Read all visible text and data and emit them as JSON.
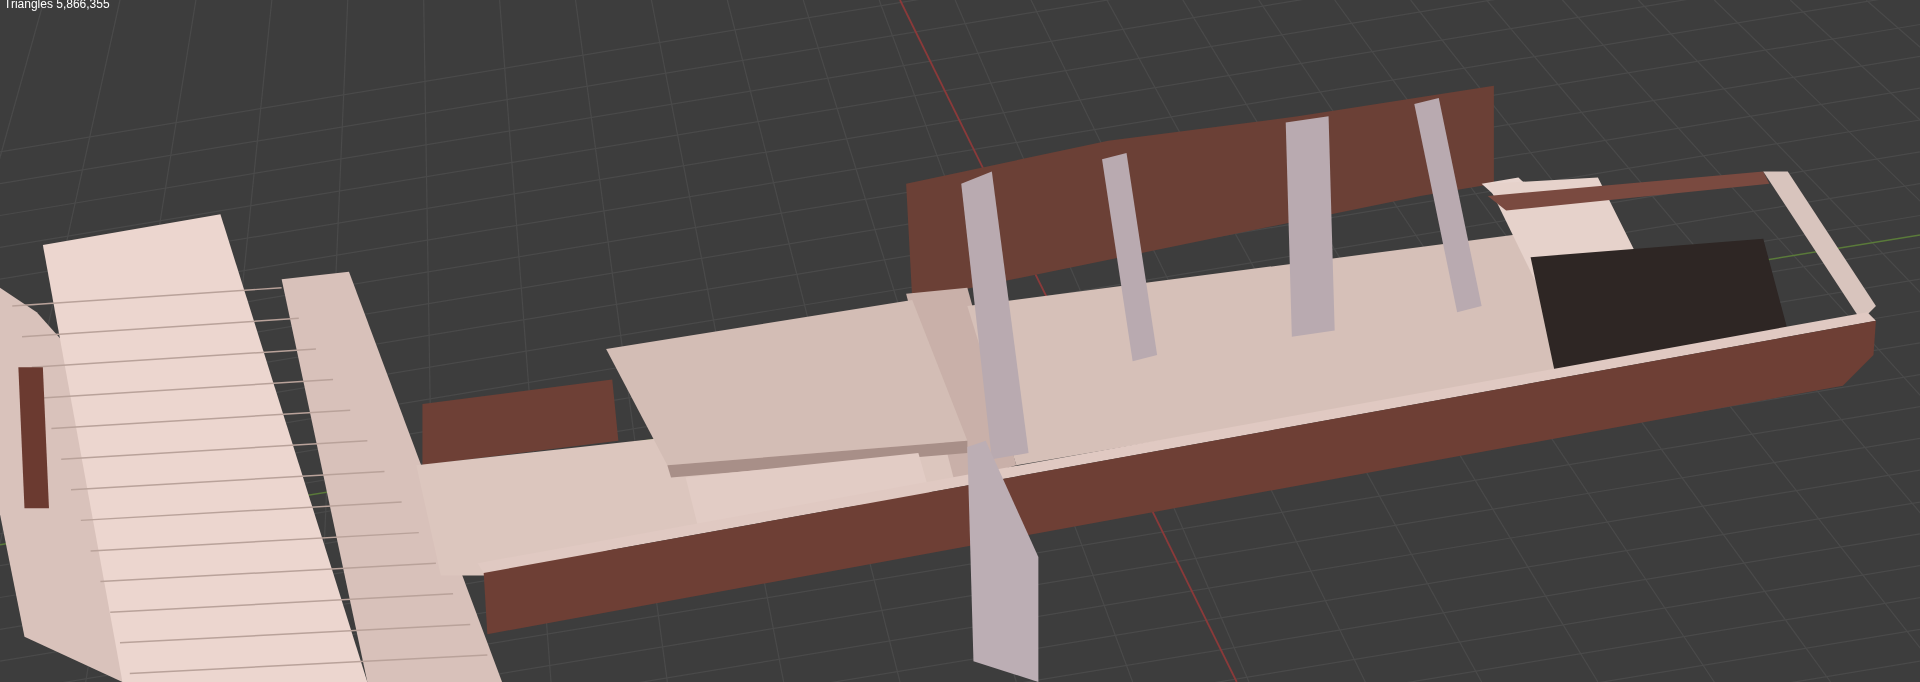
{
  "viewport": {
    "stat": "Triangles 5,866,355"
  }
}
